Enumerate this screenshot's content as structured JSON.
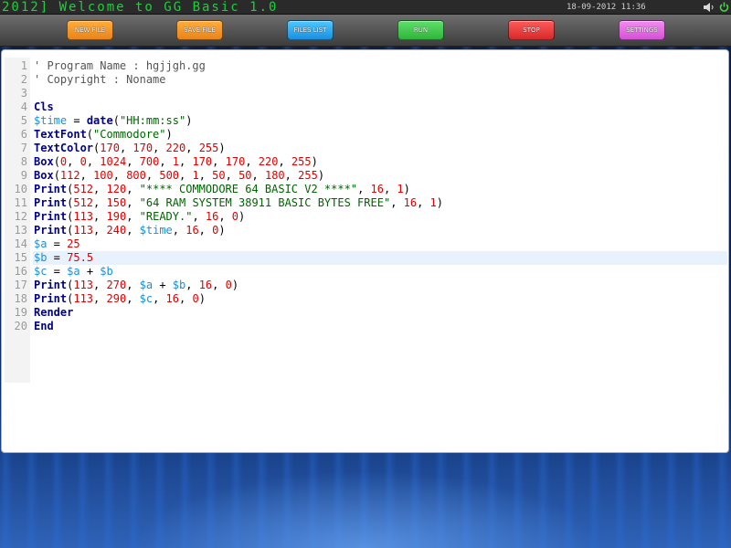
{
  "window": {
    "title": "2012] Welcome to GG Basic 1.0",
    "datetime": "18-09-2012 11:36"
  },
  "toolbar": {
    "new_file": "NEW FILE",
    "save_file": "SAVE FILE",
    "files_list": "FILES LIST",
    "run": "RUN",
    "stop": "STOP",
    "settings": "SETTINGS"
  },
  "icons": {
    "volume": "speaker-icon",
    "power": "power-icon"
  },
  "colors": {
    "title_green": "#1ecf3c",
    "keyword": "#00008b",
    "variable": "#1a8fe0",
    "number": "#e00000",
    "string": "#006400"
  },
  "editor": {
    "active_line": 15,
    "lines": [
      [
        [
          "cm",
          "' Program Name : hgjjgh.gg"
        ]
      ],
      [
        [
          "cm",
          "' Copyright : Noname"
        ]
      ],
      [],
      [
        [
          "kw",
          "Cls"
        ]
      ],
      [
        [
          "var",
          "$time"
        ],
        [
          "op",
          " = "
        ],
        [
          "kw",
          "date"
        ],
        [
          "op",
          "("
        ],
        [
          "str",
          "\"HH:mm:ss\""
        ],
        [
          "op",
          ")"
        ]
      ],
      [
        [
          "kw",
          "TextFont"
        ],
        [
          "op",
          "("
        ],
        [
          "str",
          "\"Commodore\""
        ],
        [
          "op",
          ")"
        ]
      ],
      [
        [
          "kw",
          "TextColor"
        ],
        [
          "op",
          "("
        ],
        [
          "num",
          "170"
        ],
        [
          "op",
          ", "
        ],
        [
          "num",
          "170"
        ],
        [
          "op",
          ", "
        ],
        [
          "num",
          "220"
        ],
        [
          "op",
          ", "
        ],
        [
          "num",
          "255"
        ],
        [
          "op",
          ")"
        ]
      ],
      [
        [
          "kw",
          "Box"
        ],
        [
          "op",
          "("
        ],
        [
          "num",
          "0"
        ],
        [
          "op",
          ", "
        ],
        [
          "num",
          "0"
        ],
        [
          "op",
          ", "
        ],
        [
          "num",
          "1024"
        ],
        [
          "op",
          ", "
        ],
        [
          "num",
          "700"
        ],
        [
          "op",
          ", "
        ],
        [
          "num",
          "1"
        ],
        [
          "op",
          ", "
        ],
        [
          "num",
          "170"
        ],
        [
          "op",
          ", "
        ],
        [
          "num",
          "170"
        ],
        [
          "op",
          ", "
        ],
        [
          "num",
          "220"
        ],
        [
          "op",
          ", "
        ],
        [
          "num",
          "255"
        ],
        [
          "op",
          ")"
        ]
      ],
      [
        [
          "kw",
          "Box"
        ],
        [
          "op",
          "("
        ],
        [
          "num",
          "112"
        ],
        [
          "op",
          ", "
        ],
        [
          "num",
          "100"
        ],
        [
          "op",
          ", "
        ],
        [
          "num",
          "800"
        ],
        [
          "op",
          ", "
        ],
        [
          "num",
          "500"
        ],
        [
          "op",
          ", "
        ],
        [
          "num",
          "1"
        ],
        [
          "op",
          ", "
        ],
        [
          "num",
          "50"
        ],
        [
          "op",
          ", "
        ],
        [
          "num",
          "50"
        ],
        [
          "op",
          ", "
        ],
        [
          "num",
          "180"
        ],
        [
          "op",
          ", "
        ],
        [
          "num",
          "255"
        ],
        [
          "op",
          ")"
        ]
      ],
      [
        [
          "kw",
          "Print"
        ],
        [
          "op",
          "("
        ],
        [
          "num",
          "512"
        ],
        [
          "op",
          ", "
        ],
        [
          "num",
          "120"
        ],
        [
          "op",
          ", "
        ],
        [
          "str",
          "\"**** COMMODORE 64 BASIC V2 ****\""
        ],
        [
          "op",
          ", "
        ],
        [
          "num",
          "16"
        ],
        [
          "op",
          ", "
        ],
        [
          "num",
          "1"
        ],
        [
          "op",
          ")"
        ]
      ],
      [
        [
          "kw",
          "Print"
        ],
        [
          "op",
          "("
        ],
        [
          "num",
          "512"
        ],
        [
          "op",
          ", "
        ],
        [
          "num",
          "150"
        ],
        [
          "op",
          ", "
        ],
        [
          "str",
          "\"64 RAM SYSTEM 38911 BASIC BYTES FREE\""
        ],
        [
          "op",
          ", "
        ],
        [
          "num",
          "16"
        ],
        [
          "op",
          ", "
        ],
        [
          "num",
          "1"
        ],
        [
          "op",
          ")"
        ]
      ],
      [
        [
          "kw",
          "Print"
        ],
        [
          "op",
          "("
        ],
        [
          "num",
          "113"
        ],
        [
          "op",
          ", "
        ],
        [
          "num",
          "190"
        ],
        [
          "op",
          ", "
        ],
        [
          "str",
          "\"READY.\""
        ],
        [
          "op",
          ", "
        ],
        [
          "num",
          "16"
        ],
        [
          "op",
          ", "
        ],
        [
          "num",
          "0"
        ],
        [
          "op",
          ")"
        ]
      ],
      [
        [
          "kw",
          "Print"
        ],
        [
          "op",
          "("
        ],
        [
          "num",
          "113"
        ],
        [
          "op",
          ", "
        ],
        [
          "num",
          "240"
        ],
        [
          "op",
          ", "
        ],
        [
          "var",
          "$time"
        ],
        [
          "op",
          ", "
        ],
        [
          "num",
          "16"
        ],
        [
          "op",
          ", "
        ],
        [
          "num",
          "0"
        ],
        [
          "op",
          ")"
        ]
      ],
      [
        [
          "var",
          "$a"
        ],
        [
          "op",
          " = "
        ],
        [
          "num",
          "25"
        ]
      ],
      [
        [
          "var",
          "$b"
        ],
        [
          "op",
          " = "
        ],
        [
          "num",
          "75.5"
        ]
      ],
      [
        [
          "var",
          "$c"
        ],
        [
          "op",
          " = "
        ],
        [
          "var",
          "$a"
        ],
        [
          "op",
          " + "
        ],
        [
          "var",
          "$b"
        ]
      ],
      [
        [
          "kw",
          "Print"
        ],
        [
          "op",
          "("
        ],
        [
          "num",
          "113"
        ],
        [
          "op",
          ", "
        ],
        [
          "num",
          "270"
        ],
        [
          "op",
          ", "
        ],
        [
          "var",
          "$a"
        ],
        [
          "op",
          " + "
        ],
        [
          "var",
          "$b"
        ],
        [
          "op",
          ", "
        ],
        [
          "num",
          "16"
        ],
        [
          "op",
          ", "
        ],
        [
          "num",
          "0"
        ],
        [
          "op",
          ")"
        ]
      ],
      [
        [
          "kw",
          "Print"
        ],
        [
          "op",
          "("
        ],
        [
          "num",
          "113"
        ],
        [
          "op",
          ", "
        ],
        [
          "num",
          "290"
        ],
        [
          "op",
          ", "
        ],
        [
          "var",
          "$c"
        ],
        [
          "op",
          ", "
        ],
        [
          "num",
          "16"
        ],
        [
          "op",
          ", "
        ],
        [
          "num",
          "0"
        ],
        [
          "op",
          ")"
        ]
      ],
      [
        [
          "kw",
          "Render"
        ]
      ],
      [
        [
          "kw",
          "End"
        ]
      ]
    ]
  }
}
